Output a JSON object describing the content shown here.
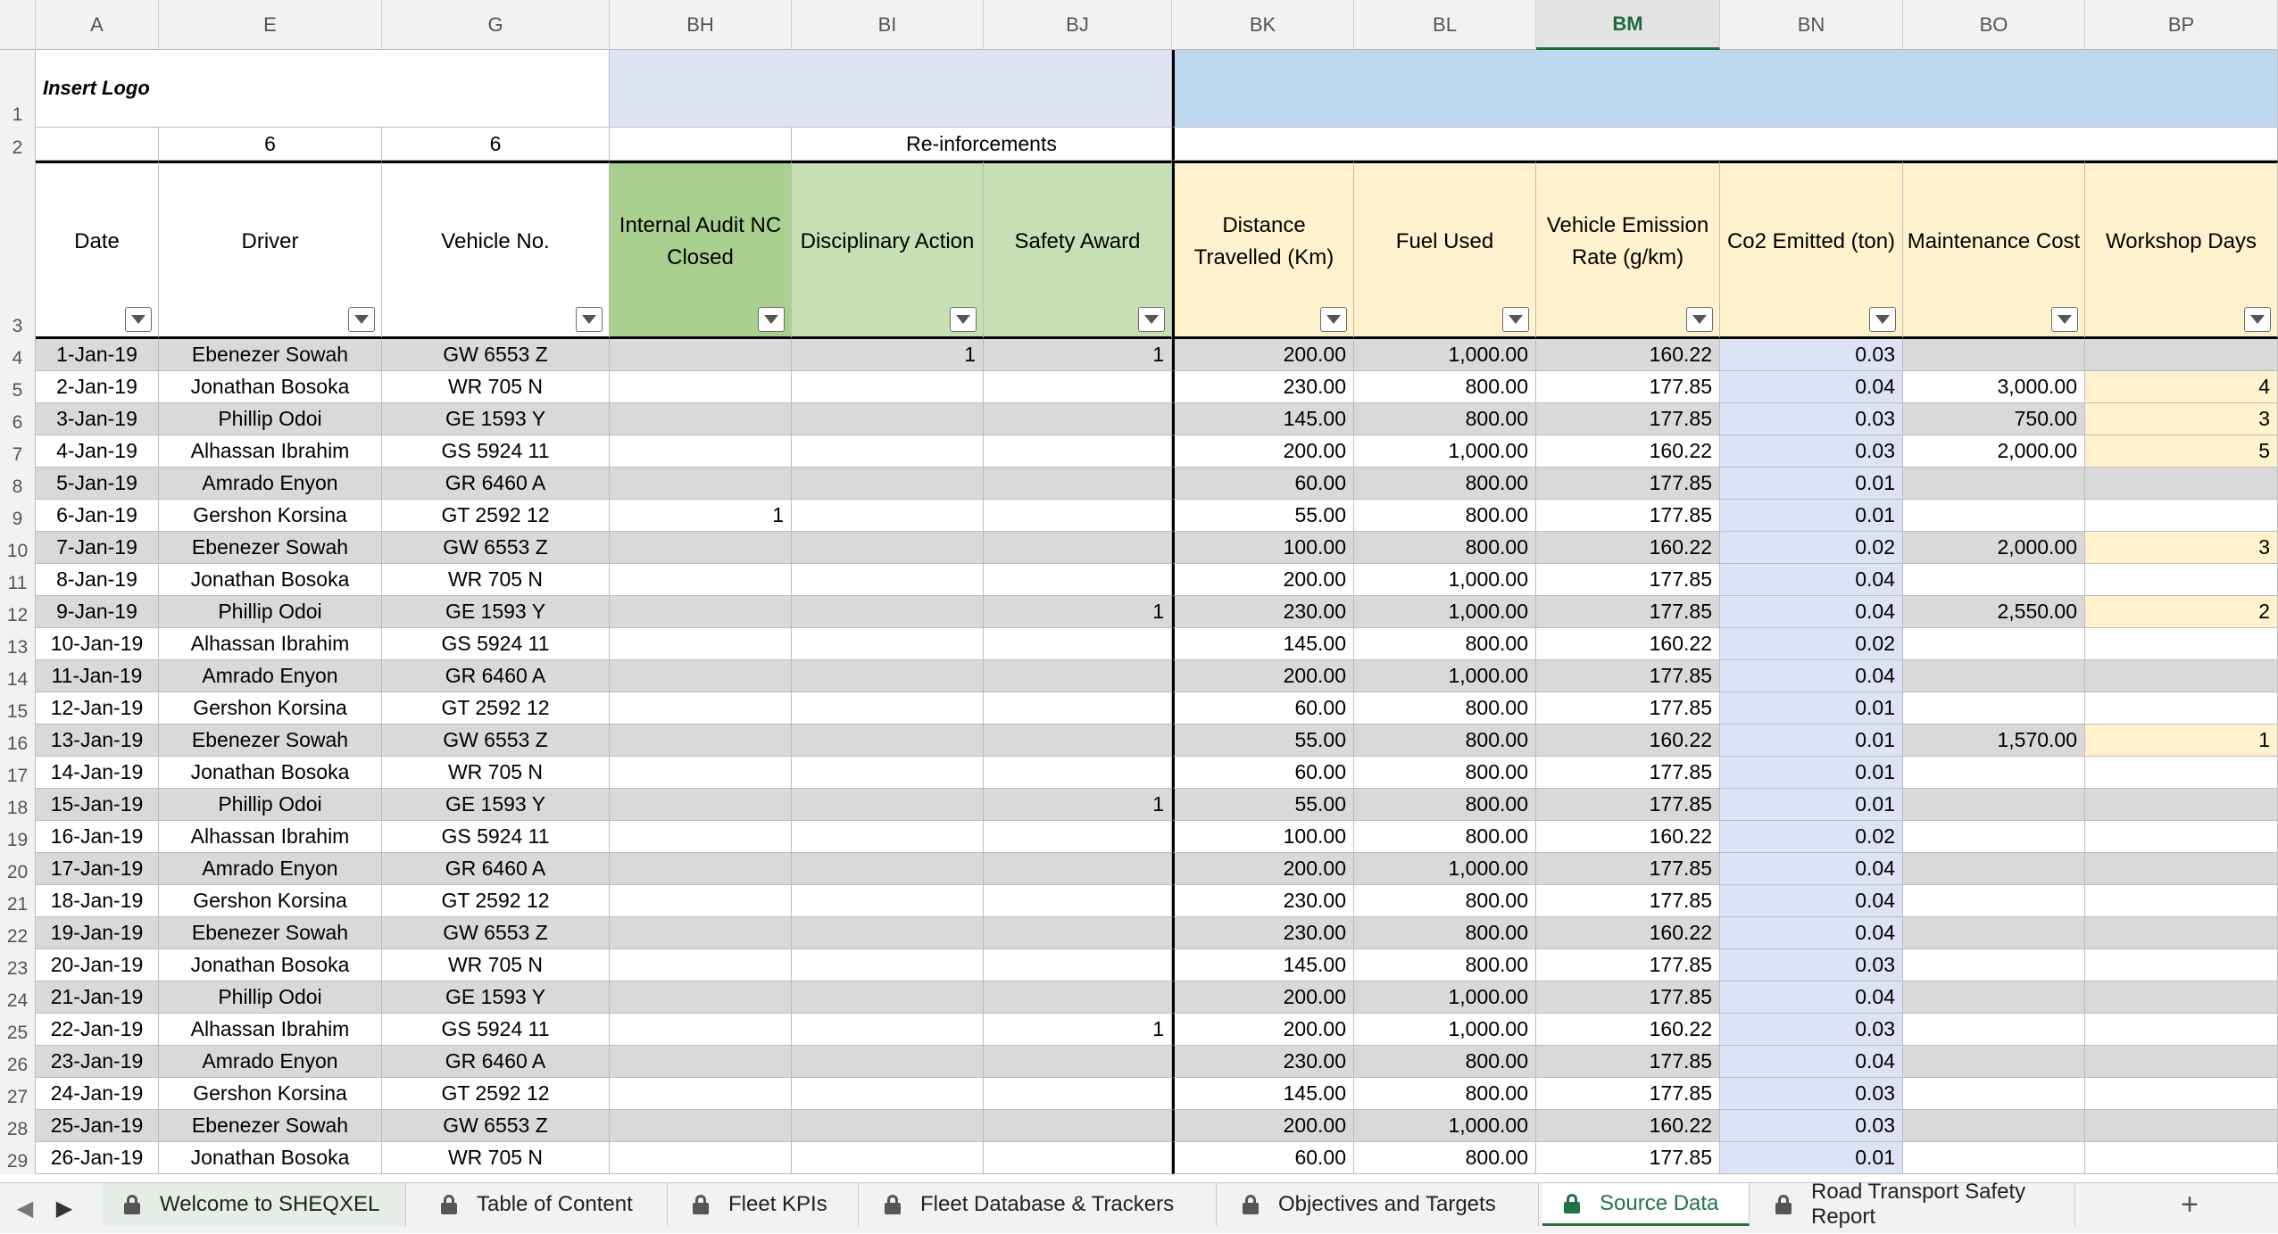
{
  "workbook": {
    "logo_text": "Insert Logo",
    "columns": [
      "A",
      "E",
      "G",
      "BH",
      "BI",
      "BJ",
      "BK",
      "BL",
      "BM",
      "BN",
      "BO",
      "BP"
    ],
    "active_column": "BM",
    "row2": {
      "E": "6",
      "G": "6",
      "group_label": "Re-inforcements"
    },
    "headers": [
      "Date",
      "Driver",
      "Vehicle No.",
      "Internal Audit NC Closed",
      "Disciplinary Action",
      "Safety Award",
      "Distance Travelled (Km)",
      "Fuel Used",
      "Vehicle Emission Rate (g/km)",
      "Co2 Emitted (ton)",
      "Maintenance Cost",
      "Workshop Days"
    ],
    "rows": [
      {
        "n": "4",
        "d": "1-Jan-19",
        "drv": "Ebenezer Sowah",
        "veh": "GW 6553 Z",
        "nc": "",
        "disc": "1",
        "award": "1",
        "dist": "200.00",
        "fuel": "1,000.00",
        "rate": "160.22",
        "co2": "0.03",
        "cost": "",
        "days": ""
      },
      {
        "n": "5",
        "d": "2-Jan-19",
        "drv": "Jonathan Bosoka",
        "veh": "WR 705 N",
        "nc": "",
        "disc": "",
        "award": "",
        "dist": "230.00",
        "fuel": "800.00",
        "rate": "177.85",
        "co2": "0.04",
        "cost": "3,000.00",
        "days": "4"
      },
      {
        "n": "6",
        "d": "3-Jan-19",
        "drv": "Phillip Odoi",
        "veh": "GE 1593 Y",
        "nc": "",
        "disc": "",
        "award": "",
        "dist": "145.00",
        "fuel": "800.00",
        "rate": "177.85",
        "co2": "0.03",
        "cost": "750.00",
        "days": "3"
      },
      {
        "n": "7",
        "d": "4-Jan-19",
        "drv": "Alhassan Ibrahim",
        "veh": "GS 5924 11",
        "nc": "",
        "disc": "",
        "award": "",
        "dist": "200.00",
        "fuel": "1,000.00",
        "rate": "160.22",
        "co2": "0.03",
        "cost": "2,000.00",
        "days": "5"
      },
      {
        "n": "8",
        "d": "5-Jan-19",
        "drv": "Amrado Enyon",
        "veh": "GR 6460 A",
        "nc": "",
        "disc": "",
        "award": "",
        "dist": "60.00",
        "fuel": "800.00",
        "rate": "177.85",
        "co2": "0.01",
        "cost": "",
        "days": ""
      },
      {
        "n": "9",
        "d": "6-Jan-19",
        "drv": "Gershon Korsina",
        "veh": "GT 2592 12",
        "nc": "1",
        "disc": "",
        "award": "",
        "dist": "55.00",
        "fuel": "800.00",
        "rate": "177.85",
        "co2": "0.01",
        "cost": "",
        "days": ""
      },
      {
        "n": "10",
        "d": "7-Jan-19",
        "drv": "Ebenezer Sowah",
        "veh": "GW 6553 Z",
        "nc": "",
        "disc": "",
        "award": "",
        "dist": "100.00",
        "fuel": "800.00",
        "rate": "160.22",
        "co2": "0.02",
        "cost": "2,000.00",
        "days": "3"
      },
      {
        "n": "11",
        "d": "8-Jan-19",
        "drv": "Jonathan Bosoka",
        "veh": "WR 705 N",
        "nc": "",
        "disc": "",
        "award": "",
        "dist": "200.00",
        "fuel": "1,000.00",
        "rate": "177.85",
        "co2": "0.04",
        "cost": "",
        "days": ""
      },
      {
        "n": "12",
        "d": "9-Jan-19",
        "drv": "Phillip Odoi",
        "veh": "GE 1593 Y",
        "nc": "",
        "disc": "",
        "award": "1",
        "dist": "230.00",
        "fuel": "1,000.00",
        "rate": "177.85",
        "co2": "0.04",
        "cost": "2,550.00",
        "days": "2"
      },
      {
        "n": "13",
        "d": "10-Jan-19",
        "drv": "Alhassan Ibrahim",
        "veh": "GS 5924 11",
        "nc": "",
        "disc": "",
        "award": "",
        "dist": "145.00",
        "fuel": "800.00",
        "rate": "160.22",
        "co2": "0.02",
        "cost": "",
        "days": ""
      },
      {
        "n": "14",
        "d": "11-Jan-19",
        "drv": "Amrado Enyon",
        "veh": "GR 6460 A",
        "nc": "",
        "disc": "",
        "award": "",
        "dist": "200.00",
        "fuel": "1,000.00",
        "rate": "177.85",
        "co2": "0.04",
        "cost": "",
        "days": ""
      },
      {
        "n": "15",
        "d": "12-Jan-19",
        "drv": "Gershon Korsina",
        "veh": "GT 2592 12",
        "nc": "",
        "disc": "",
        "award": "",
        "dist": "60.00",
        "fuel": "800.00",
        "rate": "177.85",
        "co2": "0.01",
        "cost": "",
        "days": ""
      },
      {
        "n": "16",
        "d": "13-Jan-19",
        "drv": "Ebenezer Sowah",
        "veh": "GW 6553 Z",
        "nc": "",
        "disc": "",
        "award": "",
        "dist": "55.00",
        "fuel": "800.00",
        "rate": "160.22",
        "co2": "0.01",
        "cost": "1,570.00",
        "days": "1"
      },
      {
        "n": "17",
        "d": "14-Jan-19",
        "drv": "Jonathan Bosoka",
        "veh": "WR 705 N",
        "nc": "",
        "disc": "",
        "award": "",
        "dist": "60.00",
        "fuel": "800.00",
        "rate": "177.85",
        "co2": "0.01",
        "cost": "",
        "days": ""
      },
      {
        "n": "18",
        "d": "15-Jan-19",
        "drv": "Phillip Odoi",
        "veh": "GE 1593 Y",
        "nc": "",
        "disc": "",
        "award": "1",
        "dist": "55.00",
        "fuel": "800.00",
        "rate": "177.85",
        "co2": "0.01",
        "cost": "",
        "days": ""
      },
      {
        "n": "19",
        "d": "16-Jan-19",
        "drv": "Alhassan Ibrahim",
        "veh": "GS 5924 11",
        "nc": "",
        "disc": "",
        "award": "",
        "dist": "100.00",
        "fuel": "800.00",
        "rate": "160.22",
        "co2": "0.02",
        "cost": "",
        "days": ""
      },
      {
        "n": "20",
        "d": "17-Jan-19",
        "drv": "Amrado Enyon",
        "veh": "GR 6460 A",
        "nc": "",
        "disc": "",
        "award": "",
        "dist": "200.00",
        "fuel": "1,000.00",
        "rate": "177.85",
        "co2": "0.04",
        "cost": "",
        "days": ""
      },
      {
        "n": "21",
        "d": "18-Jan-19",
        "drv": "Gershon Korsina",
        "veh": "GT 2592 12",
        "nc": "",
        "disc": "",
        "award": "",
        "dist": "230.00",
        "fuel": "800.00",
        "rate": "177.85",
        "co2": "0.04",
        "cost": "",
        "days": ""
      },
      {
        "n": "22",
        "d": "19-Jan-19",
        "drv": "Ebenezer Sowah",
        "veh": "GW 6553 Z",
        "nc": "",
        "disc": "",
        "award": "",
        "dist": "230.00",
        "fuel": "800.00",
        "rate": "160.22",
        "co2": "0.04",
        "cost": "",
        "days": ""
      },
      {
        "n": "23",
        "d": "20-Jan-19",
        "drv": "Jonathan Bosoka",
        "veh": "WR 705 N",
        "nc": "",
        "disc": "",
        "award": "",
        "dist": "145.00",
        "fuel": "800.00",
        "rate": "177.85",
        "co2": "0.03",
        "cost": "",
        "days": ""
      },
      {
        "n": "24",
        "d": "21-Jan-19",
        "drv": "Phillip Odoi",
        "veh": "GE 1593 Y",
        "nc": "",
        "disc": "",
        "award": "",
        "dist": "200.00",
        "fuel": "1,000.00",
        "rate": "177.85",
        "co2": "0.04",
        "cost": "",
        "days": ""
      },
      {
        "n": "25",
        "d": "22-Jan-19",
        "drv": "Alhassan Ibrahim",
        "veh": "GS 5924 11",
        "nc": "",
        "disc": "",
        "award": "1",
        "dist": "200.00",
        "fuel": "1,000.00",
        "rate": "160.22",
        "co2": "0.03",
        "cost": "",
        "days": ""
      },
      {
        "n": "26",
        "d": "23-Jan-19",
        "drv": "Amrado Enyon",
        "veh": "GR 6460 A",
        "nc": "",
        "disc": "",
        "award": "",
        "dist": "230.00",
        "fuel": "800.00",
        "rate": "177.85",
        "co2": "0.04",
        "cost": "",
        "days": ""
      },
      {
        "n": "27",
        "d": "24-Jan-19",
        "drv": "Gershon Korsina",
        "veh": "GT 2592 12",
        "nc": "",
        "disc": "",
        "award": "",
        "dist": "145.00",
        "fuel": "800.00",
        "rate": "177.85",
        "co2": "0.03",
        "cost": "",
        "days": ""
      },
      {
        "n": "28",
        "d": "25-Jan-19",
        "drv": "Ebenezer Sowah",
        "veh": "GW 6553 Z",
        "nc": "",
        "disc": "",
        "award": "",
        "dist": "200.00",
        "fuel": "1,000.00",
        "rate": "160.22",
        "co2": "0.03",
        "cost": "",
        "days": ""
      },
      {
        "n": "29",
        "d": "26-Jan-19",
        "drv": "Jonathan Bosoka",
        "veh": "WR 705 N",
        "nc": "",
        "disc": "",
        "award": "",
        "dist": "60.00",
        "fuel": "800.00",
        "rate": "177.85",
        "co2": "0.01",
        "cost": "",
        "days": ""
      }
    ]
  },
  "tabs": [
    {
      "label": "Welcome to SHEQXEL",
      "active": false
    },
    {
      "label": "Table of Content",
      "active": false
    },
    {
      "label": "Fleet KPIs",
      "active": false
    },
    {
      "label": "Fleet Database & Trackers",
      "active": false
    },
    {
      "label": "Objectives and Targets",
      "active": false
    },
    {
      "label": "Source Data",
      "active": true
    },
    {
      "label": "Road Transport Safety Report",
      "active": false
    }
  ],
  "tabbar": {
    "prev_icon": "chevron-left-icon",
    "next_icon": "chevron-right-icon",
    "add_icon": "plus-icon",
    "add_symbol": "+",
    "lock_icon": "lock-icon"
  },
  "colors": {
    "accent": "#217346",
    "row_stripe": "#d9d9d9",
    "header_green": "#c6e0b4",
    "header_green_dark": "#a9d08e",
    "header_yellow": "#fff2cc",
    "header_blue": "#dde3f3",
    "banner_blue": "#bdd7ee",
    "co2_blue": "#dce3f5",
    "workshop_yellow": "#fff2cc"
  }
}
